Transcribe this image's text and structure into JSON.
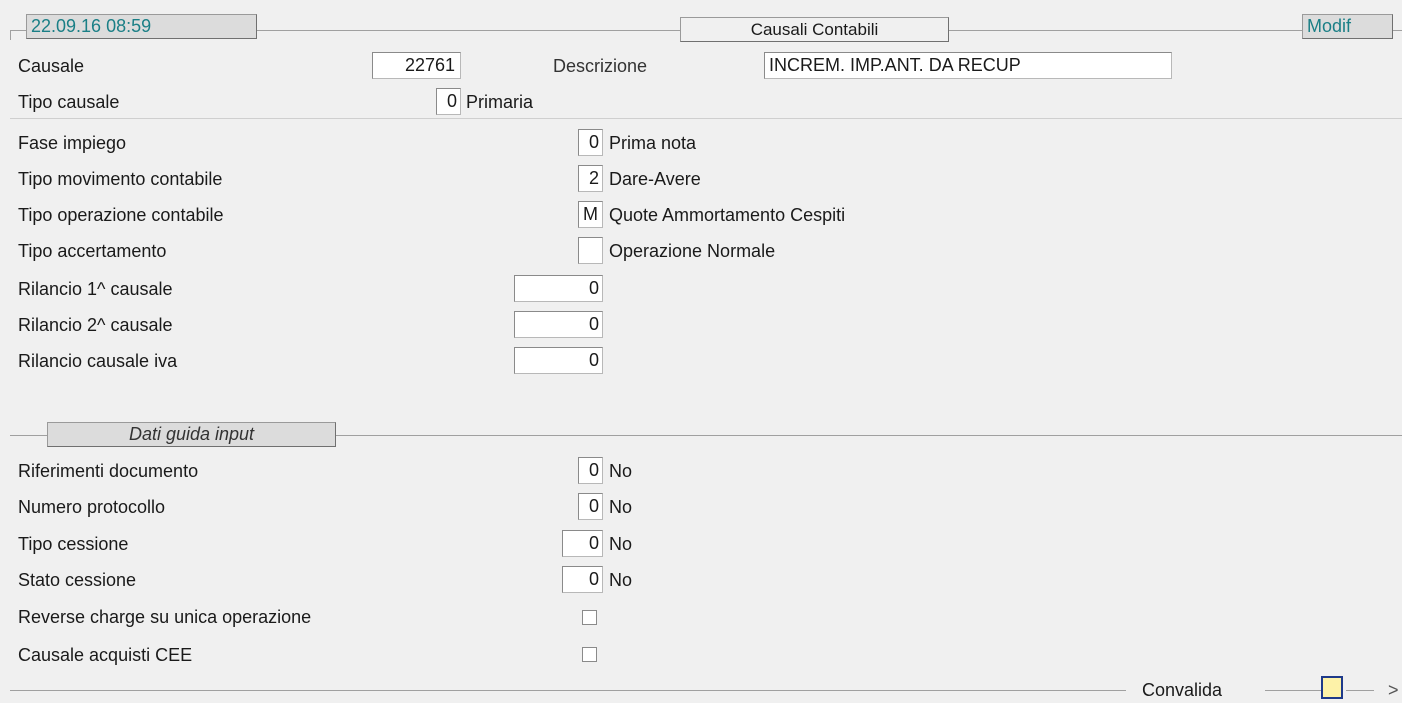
{
  "header": {
    "datetime": "22.09.16 08:59",
    "title": "Causali Contabili",
    "mode": "Modif"
  },
  "causale": {
    "label": "Causale",
    "value": "22761"
  },
  "descrizione": {
    "label": "Descrizione",
    "value": "INCREM. IMP.ANT. DA RECUP"
  },
  "tipo_causale": {
    "label": "Tipo causale",
    "value": "0",
    "desc": "Primaria"
  },
  "fase_impiego": {
    "label": "Fase impiego",
    "value": "0",
    "desc": "Prima nota"
  },
  "tipo_movimento": {
    "label": "Tipo movimento contabile",
    "value": "2",
    "desc": "Dare-Avere"
  },
  "tipo_operazione": {
    "label": "Tipo operazione contabile",
    "value": "M",
    "desc": "Quote Ammortamento Cespiti"
  },
  "tipo_accertamento": {
    "label": "Tipo accertamento",
    "value": "",
    "desc": "Operazione Normale"
  },
  "rilancio1": {
    "label": "Rilancio 1^ causale",
    "value": "0"
  },
  "rilancio2": {
    "label": "Rilancio 2^ causale",
    "value": "0"
  },
  "rilancio_iva": {
    "label": "Rilancio causale iva",
    "value": "0"
  },
  "section_title": "Dati guida input",
  "riferimenti": {
    "label": "Riferimenti documento",
    "value": "0",
    "desc": "No"
  },
  "protocollo": {
    "label": "Numero protocollo",
    "value": "0",
    "desc": "No"
  },
  "tipo_cessione": {
    "label": "Tipo cessione",
    "value": "0",
    "desc": "No"
  },
  "stato_cessione": {
    "label": "Stato cessione",
    "value": "0",
    "desc": "No"
  },
  "reverse_charge": {
    "label": "Reverse charge su unica operazione",
    "checked": false
  },
  "acquisti_cee": {
    "label": "Causale acquisti CEE",
    "checked": false
  },
  "footer": {
    "convalida": "Convalida",
    "more": ">"
  },
  "colors": {
    "header_text": "#1a7f86",
    "button_fill": "#fdf2a8",
    "button_border": "#1e3a8a"
  }
}
